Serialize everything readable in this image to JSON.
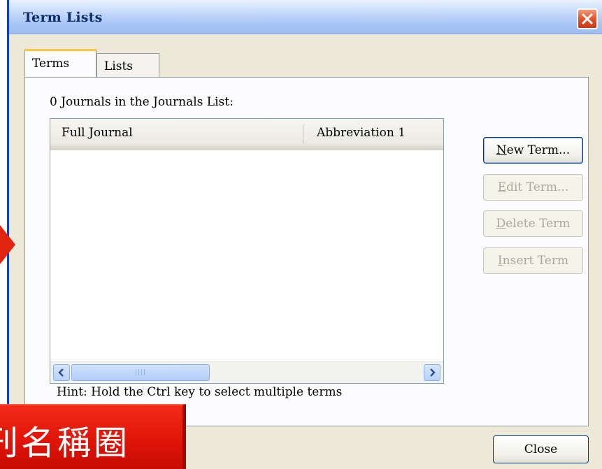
{
  "window": {
    "title": "Term Lists"
  },
  "tabs": [
    {
      "label": "Terms",
      "active": true
    },
    {
      "label": "Lists",
      "active": false
    }
  ],
  "list": {
    "count_label": "0 Journals in the Journals List:",
    "columns": [
      "Full Journal",
      "Abbreviation 1"
    ],
    "rows": []
  },
  "buttons": {
    "new_term": {
      "accel": "N",
      "rest": "ew Term...",
      "enabled": true
    },
    "edit_term": {
      "accel": "E",
      "rest": "dit Term...",
      "enabled": false
    },
    "delete_term": {
      "accel": "D",
      "rest": "elete Term",
      "enabled": false
    },
    "insert_term": {
      "accel": "I",
      "rest": "nsert Term",
      "enabled": false
    },
    "close": "Close"
  },
  "hint": "Hint: Hold the Ctrl key to select multiple terms",
  "overlay": {
    "banner_text": "刊名稱圈",
    "colors": {
      "banner": "#e01508",
      "arrow": "#e02410"
    }
  },
  "colors": {
    "window_bg": "#ece9d8",
    "title_text": "#0b2b6e",
    "close_button": "#e0532c",
    "tab_highlight": "#ffc83c",
    "disabled_text": "#aca899"
  },
  "icons": {
    "close": "close-x-icon",
    "scroll_left": "chevron-left-icon",
    "scroll_right": "chevron-right-icon"
  }
}
